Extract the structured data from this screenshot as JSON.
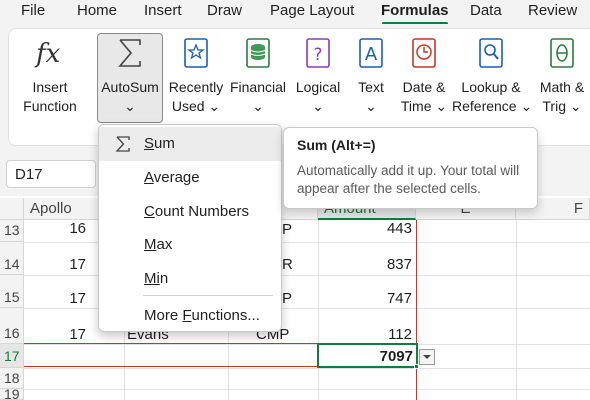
{
  "menu": {
    "tabs": [
      {
        "label": "File"
      },
      {
        "label": "Home"
      },
      {
        "label": "Insert"
      },
      {
        "label": "Draw"
      },
      {
        "label": "Page Layout"
      },
      {
        "label": "Formulas"
      },
      {
        "label": "Data"
      },
      {
        "label": "Review"
      }
    ],
    "active": "Formulas",
    "accent_color": "#107c41"
  },
  "ribbon": {
    "insert_function": {
      "line1": "Insert",
      "line2": "Function",
      "icon": "fx-icon"
    },
    "autosum": {
      "line1": "AutoSum",
      "line2": "⌄",
      "icon": "sigma-icon"
    },
    "recently_used": {
      "line1": "Recently",
      "line2": "Used ⌄",
      "icon": "star-book-icon"
    },
    "financial": {
      "line1": "Financial",
      "line2": "⌄",
      "icon": "coins-icon"
    },
    "logical": {
      "line1": "Logical",
      "line2": "⌄",
      "icon": "question-book-icon"
    },
    "text": {
      "line1": "Text",
      "line2": "⌄",
      "icon": "letter-a-book-icon"
    },
    "date_time": {
      "line1": "Date &",
      "line2": "Time ⌄",
      "icon": "clock-book-icon"
    },
    "lookup": {
      "line1": "Lookup &",
      "line2": "Reference ⌄",
      "icon": "magnifier-book-icon"
    },
    "math": {
      "line1": "Math &",
      "line2": "Trig ⌄",
      "icon": "theta-book-icon"
    }
  },
  "namebox": {
    "value": "D17"
  },
  "grid": {
    "columns": [
      "Apollo",
      "Amount",
      "E",
      "F"
    ],
    "rows": [
      "13",
      "14",
      "15",
      "16",
      "17",
      "18",
      "19"
    ],
    "apollo_values": [
      "16",
      "17",
      "17",
      "17"
    ],
    "col_c_partial": [
      "P",
      "R",
      "P",
      "CMP"
    ],
    "col_b_partial": "Evans",
    "amounts": [
      "443",
      "837",
      "747",
      "112"
    ],
    "total": "7097"
  },
  "dropdown": {
    "items": [
      {
        "label_u": "S",
        "label_rest": "um",
        "icon": "sigma-icon"
      },
      {
        "label_u": "A",
        "label_rest": "verage"
      },
      {
        "label_u": "C",
        "label_rest": "ount Numbers"
      },
      {
        "label_u": "M",
        "label_rest": "ax"
      },
      {
        "label_u": "Mi",
        "label_rest": "n"
      },
      {
        "label_pre": "More ",
        "label_u": "F",
        "label_rest": "unctions..."
      }
    ]
  },
  "tooltip": {
    "title": "Sum (Alt+=)",
    "description": "Automatically add it up. Your total will appear after the selected cells."
  }
}
